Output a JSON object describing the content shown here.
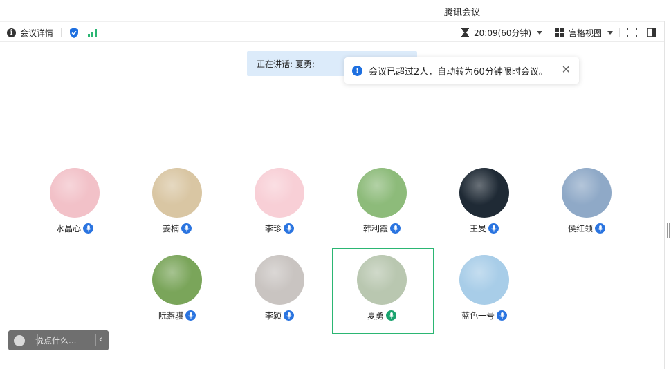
{
  "window": {
    "title": "腾讯会议"
  },
  "toolbar": {
    "meeting_info_label": "会议详情",
    "timer": "20:09(60分钟)",
    "view_label": "宫格视图"
  },
  "speaking": {
    "label": "正在讲话: 夏勇;"
  },
  "toast": {
    "message": "会议已超过2人，自动转为60分钟限时会议。",
    "close_glyph": "✕"
  },
  "participants": [
    {
      "name": "水晶心",
      "avatar_color": "#f2c1c8",
      "mic_active": false
    },
    {
      "name": "姜楠",
      "avatar_color": "#d9c6a3",
      "mic_active": false
    },
    {
      "name": "李珍",
      "avatar_color": "#f8cfd6",
      "mic_active": false
    },
    {
      "name": "韩利霞",
      "avatar_color": "#8dbb7a",
      "mic_active": false
    },
    {
      "name": "王旻",
      "avatar_color": "#1f2a35",
      "mic_active": false
    },
    {
      "name": "侯红领",
      "avatar_color": "#8fa9c7",
      "mic_active": false
    },
    {
      "name": "阮燕骐",
      "avatar_color": "#7aa55a",
      "mic_active": false
    },
    {
      "name": "李颖",
      "avatar_color": "#c9c4c1",
      "mic_active": false
    },
    {
      "name": "夏勇",
      "avatar_color": "#b9c7b0",
      "mic_active": true
    },
    {
      "name": "蓝色一号",
      "avatar_color": "#a8cde8",
      "mic_active": false
    }
  ],
  "chat": {
    "placeholder": "说点什么..."
  },
  "colors": {
    "accent": "#1d6fe0",
    "speaking_frame": "#2bb673",
    "speaking_bg": "#dcebfa"
  }
}
